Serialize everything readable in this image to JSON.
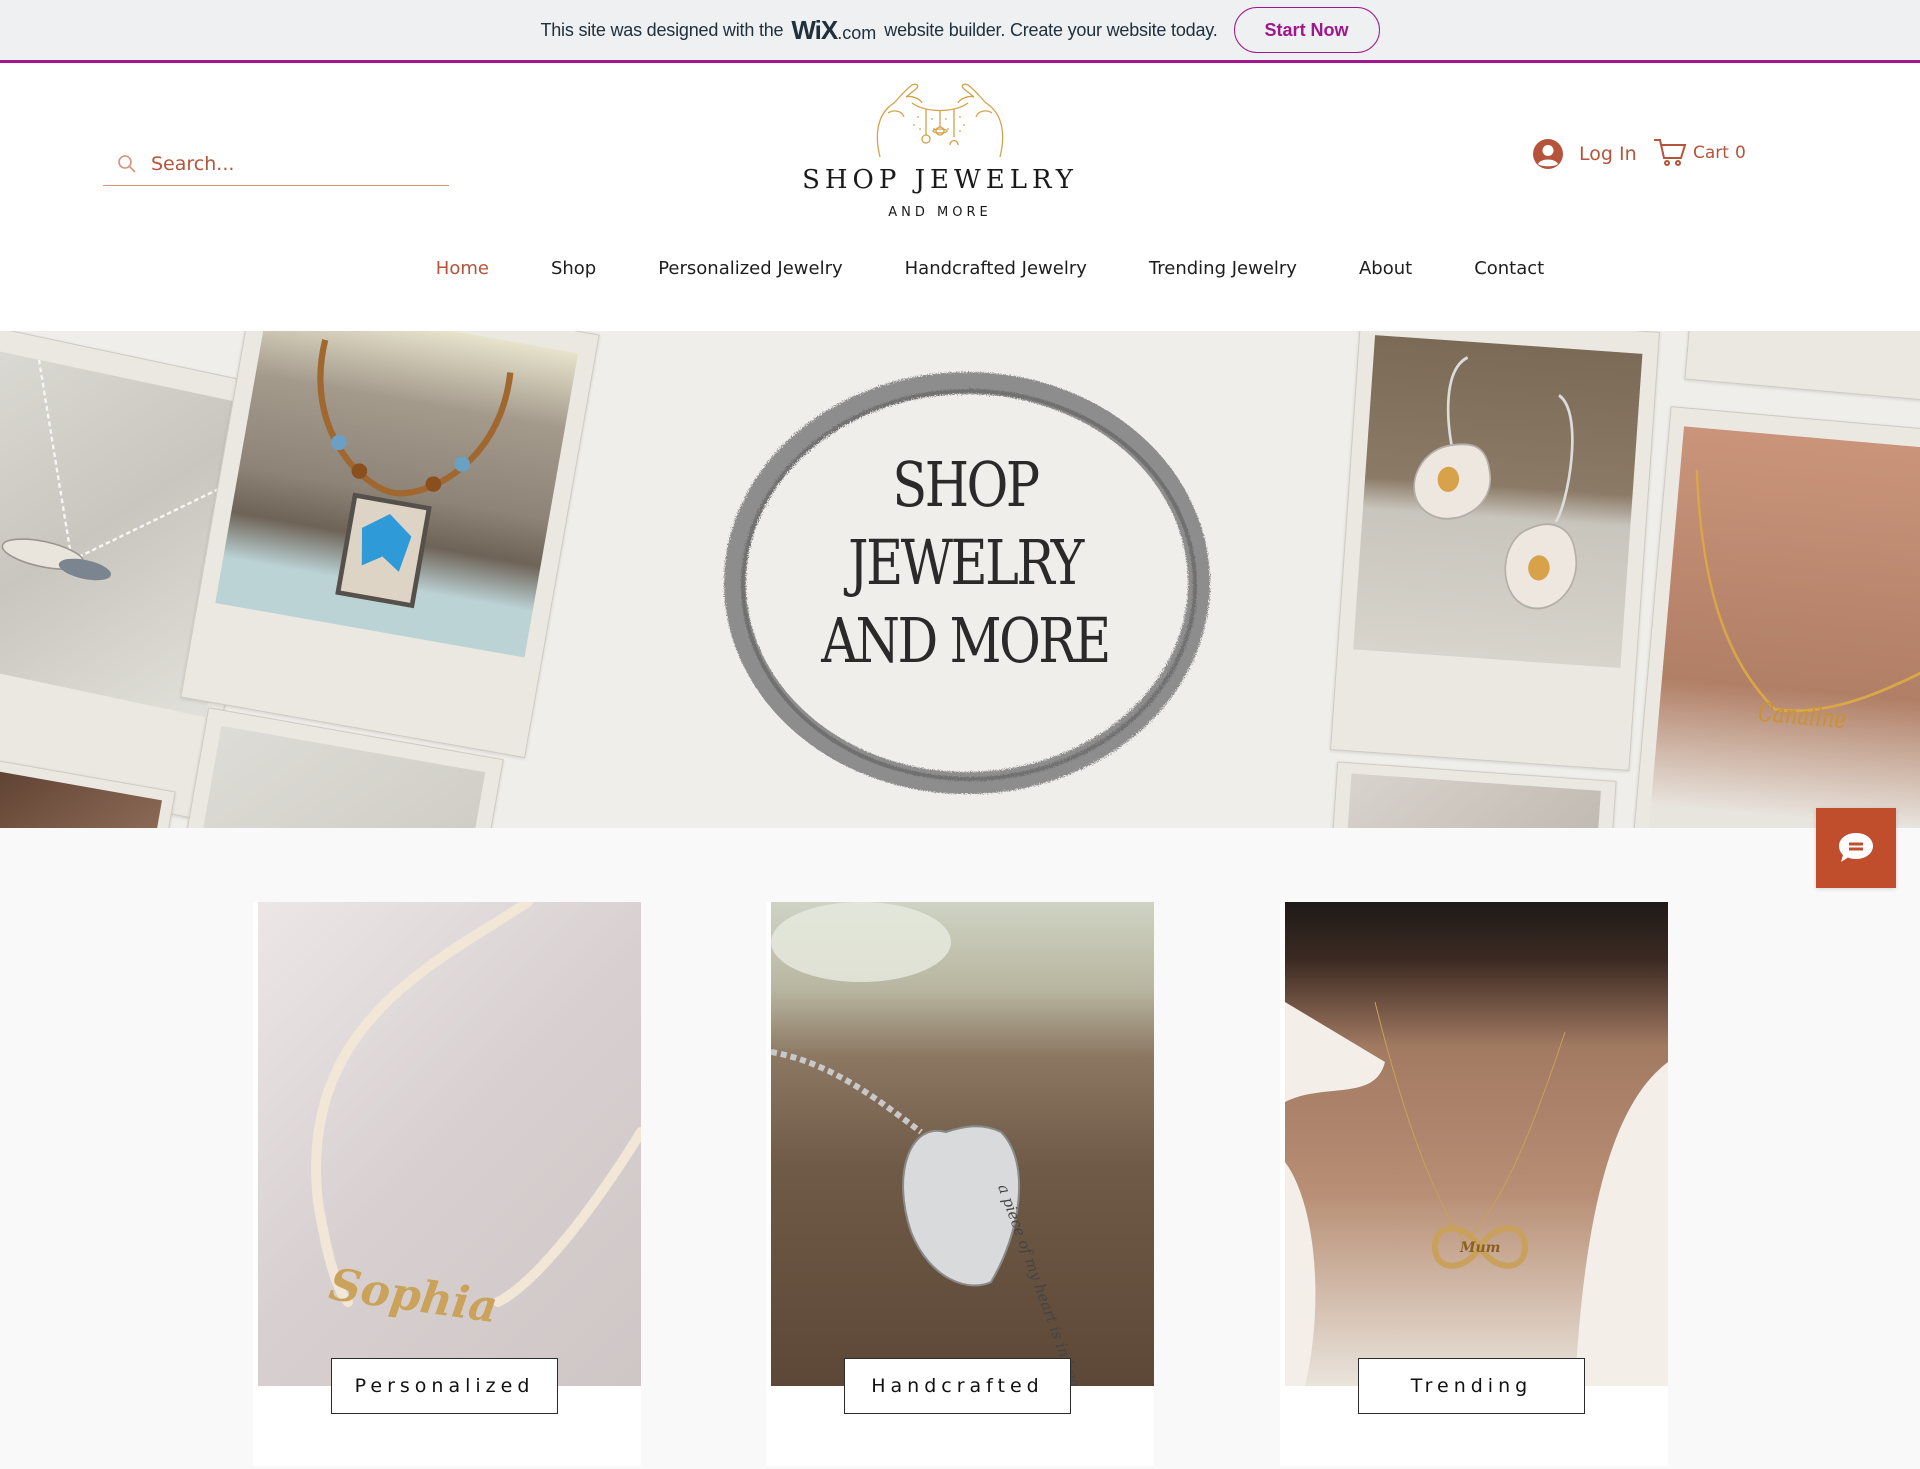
{
  "wix_banner": {
    "text_before": "This site was designed with the",
    "wix_logo": "WiX",
    "wix_domain": ".com",
    "text_after": "website builder. Create your website today.",
    "cta_label": "Start Now",
    "accent_color": "#a0178d"
  },
  "header": {
    "search": {
      "placeholder": "Search...",
      "value": "",
      "icon": "search-icon"
    },
    "logo": {
      "title": "SHOP JEWELRY",
      "subtitle": "AND MORE",
      "icon": "hands-necklace-logo-icon"
    },
    "login": {
      "label": "Log In",
      "icon": "user-avatar-icon"
    },
    "cart": {
      "label": "Cart",
      "count": "0",
      "icon": "cart-icon"
    },
    "accent_color": "#b5543a"
  },
  "nav": {
    "items": [
      {
        "label": "Home",
        "active": true
      },
      {
        "label": "Shop",
        "active": false
      },
      {
        "label": "Personalized Jewelry",
        "active": false
      },
      {
        "label": "Handcrafted Jewelry",
        "active": false
      },
      {
        "label": "Trending Jewelry",
        "active": false
      },
      {
        "label": "About",
        "active": false
      },
      {
        "label": "Contact",
        "active": false
      }
    ]
  },
  "hero": {
    "line1": "SHOP",
    "line2": "JEWELRY",
    "line3": "AND MORE",
    "images": [
      "dragonfly-necklace-photo",
      "butterfly-pendant-necklace-photo",
      "silver-necklace-photo",
      "flower-earrings-photo",
      "name-necklace-canaline-photo",
      "gold-chain-photo"
    ],
    "engraved_name": "Canaline"
  },
  "categories": [
    {
      "label": "Personalized",
      "image": "sophia-name-pearl-necklace-photo",
      "engraving": "Sophia"
    },
    {
      "label": "Handcrafted",
      "image": "heart-pendant-heaven-photo",
      "engraving": "a piece of my heart is in heaven"
    },
    {
      "label": "Trending",
      "image": "infinity-name-necklace-photo",
      "engraving": "Mum"
    }
  ],
  "chat": {
    "icon": "chat-bubble-icon",
    "color": "#c04d2b"
  }
}
